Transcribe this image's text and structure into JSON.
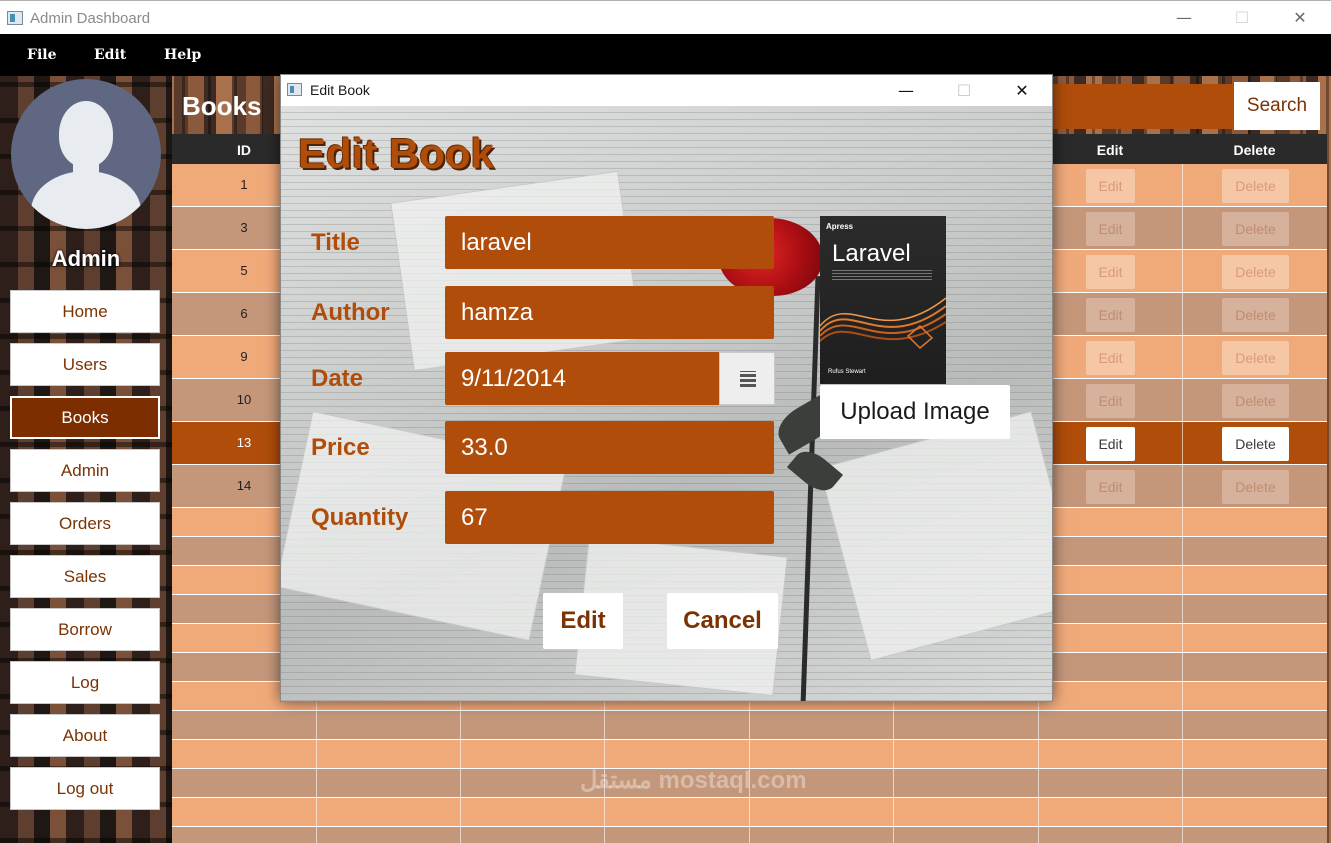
{
  "window": {
    "title": "Admin Dashboard",
    "minimize": "—",
    "maximize": "☐",
    "close": "✕"
  },
  "menu": [
    "File",
    "Edit",
    "Help"
  ],
  "sidebar": {
    "user_label": "Admin",
    "items": [
      "Home",
      "Users",
      "Books",
      "Admin",
      "Orders",
      "Sales",
      "Borrow",
      "Log",
      "About",
      "Log out"
    ],
    "active": "Books"
  },
  "page": {
    "title": "Books",
    "search_value": "",
    "search_button": "Search"
  },
  "table": {
    "headers": {
      "id": "ID",
      "edit": "Edit",
      "delete": "Delete"
    },
    "rows": [
      {
        "id": "1",
        "edit": "Edit",
        "delete": "Delete"
      },
      {
        "id": "3",
        "edit": "Edit",
        "delete": "Delete"
      },
      {
        "id": "5",
        "edit": "Edit",
        "delete": "Delete"
      },
      {
        "id": "6",
        "edit": "Edit",
        "delete": "Delete"
      },
      {
        "id": "9",
        "edit": "Edit",
        "delete": "Delete"
      },
      {
        "id": "10",
        "edit": "Edit",
        "delete": "Delete"
      },
      {
        "id": "13",
        "edit": "Edit",
        "delete": "Delete"
      },
      {
        "id": "14",
        "edit": "Edit",
        "delete": "Delete"
      }
    ],
    "selected_id": "13"
  },
  "watermark": "مستقل mostaql.com",
  "dialog": {
    "title": "Edit Book",
    "heading": "Edit Book",
    "fields": {
      "title": {
        "label": "Title",
        "value": "laravel"
      },
      "author": {
        "label": "Author",
        "value": "hamza"
      },
      "date": {
        "label": "Date",
        "value": "9/11/2014"
      },
      "price": {
        "label": "Price",
        "value": "33.0"
      },
      "quantity": {
        "label": "Quantity",
        "value": "67"
      }
    },
    "book_cover": {
      "publisher": "Apress",
      "title": "Laravel",
      "author": "Rufus Stewart"
    },
    "upload_button": "Upload Image",
    "edit_button": "Edit",
    "cancel_button": "Cancel",
    "window": {
      "minimize": "—",
      "maximize": "☐",
      "close": "✕"
    }
  },
  "colors": {
    "accent": "#b04d0a",
    "dark_accent": "#7c2e00",
    "row_light": "#f0aa7a",
    "row_dark": "#c4977b",
    "header": "#2a2a2a"
  }
}
